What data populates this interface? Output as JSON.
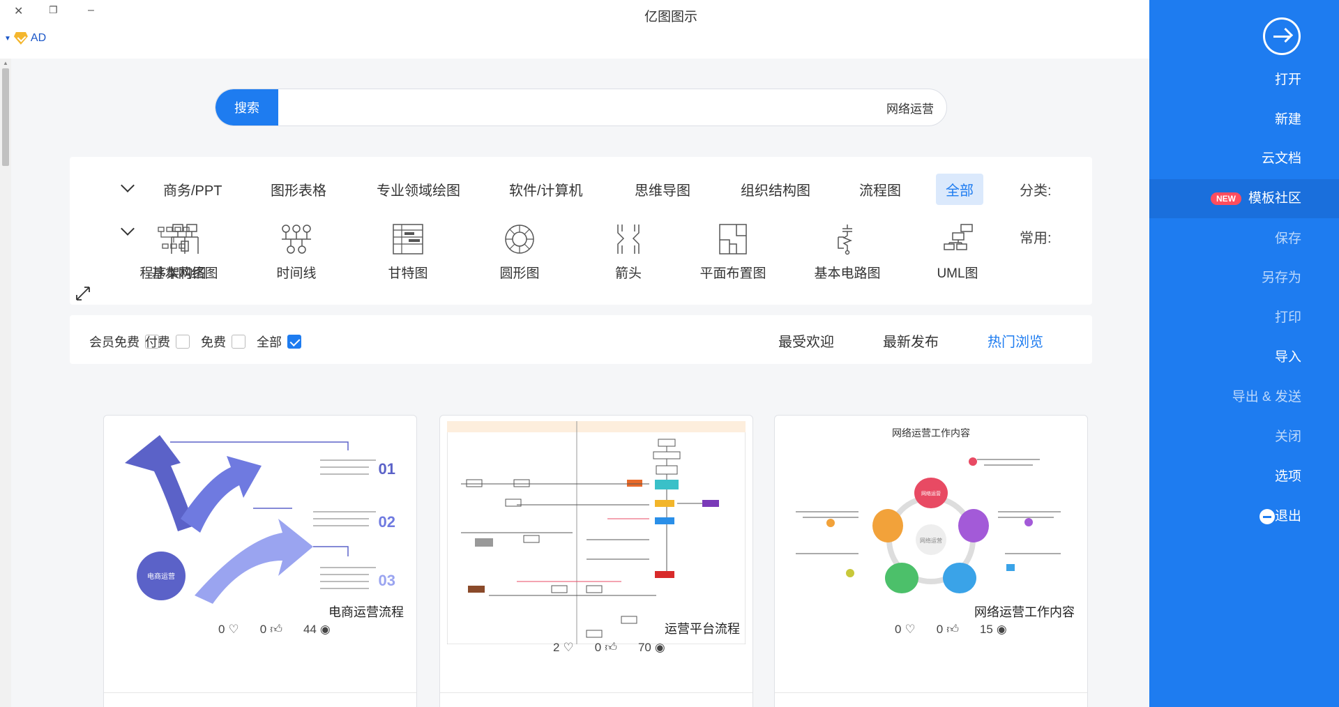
{
  "app": {
    "title": "亿图图示"
  },
  "window": {
    "close": "✕",
    "restore": "❐",
    "minimize": "–"
  },
  "account": {
    "label": "AD"
  },
  "search": {
    "button": "搜索",
    "value": "网络运营"
  },
  "categories": {
    "label": "分类:",
    "items": [
      "全部",
      "流程图",
      "组织结构图",
      "思维导图",
      "软件/计算机",
      "专业领域绘图",
      "图形表格",
      "商务/PPT"
    ],
    "active": "全部"
  },
  "common": {
    "label": "常用:",
    "items": [
      {
        "label": "UML图",
        "icon": "uml-icon"
      },
      {
        "label": "基本电路图",
        "icon": "circuit-icon"
      },
      {
        "label": "平面布置图",
        "icon": "floor-plan-icon"
      },
      {
        "label": "箭头",
        "icon": "arrow-shapes-icon"
      },
      {
        "label": "圆形图",
        "icon": "circle-diagram-icon"
      },
      {
        "label": "甘特图",
        "icon": "gantt-icon"
      },
      {
        "label": "时间线",
        "icon": "timeline-icon"
      },
      {
        "label": "基本网络图",
        "icon": "network-icon"
      },
      {
        "label": "程序架构图",
        "icon": "program-arch-icon"
      }
    ]
  },
  "filters": {
    "price": [
      {
        "label": "全部",
        "checked": true
      },
      {
        "label": "免费",
        "checked": false
      },
      {
        "label": "付费",
        "checked": false
      },
      {
        "label": "会员免费",
        "checked": false
      }
    ],
    "sort": [
      "热门浏览",
      "最新发布",
      "最受欢迎"
    ],
    "sort_active": "热门浏览"
  },
  "templates": [
    {
      "name": "网络运营工作内容",
      "views": "15",
      "likes": "0",
      "favorites": "0",
      "thumb_title": "网络运营工作内容",
      "center_text": "网络运营",
      "petal_text": "网络运营"
    },
    {
      "name": "运营平台流程",
      "views": "70",
      "likes": "0",
      "favorites": "2"
    },
    {
      "name": "电商运营流程",
      "views": "44",
      "likes": "0",
      "favorites": "0",
      "steps": [
        "01",
        "02",
        "03"
      ],
      "circle_text": "电商运营"
    }
  ],
  "sidebar": {
    "open": "打开",
    "new": "新建",
    "cloud": "云文档",
    "community": "模板社区",
    "new_badge": "NEW",
    "save": "保存",
    "save_as": "另存为",
    "print": "打印",
    "import": "导入",
    "export": "导出 & 发送",
    "close": "关闭",
    "options": "选项",
    "exit": "退出"
  },
  "colors": {
    "primary": "#1e7cf0",
    "badge": "#ff4d5e",
    "sidebar": "#1e7cf0"
  }
}
